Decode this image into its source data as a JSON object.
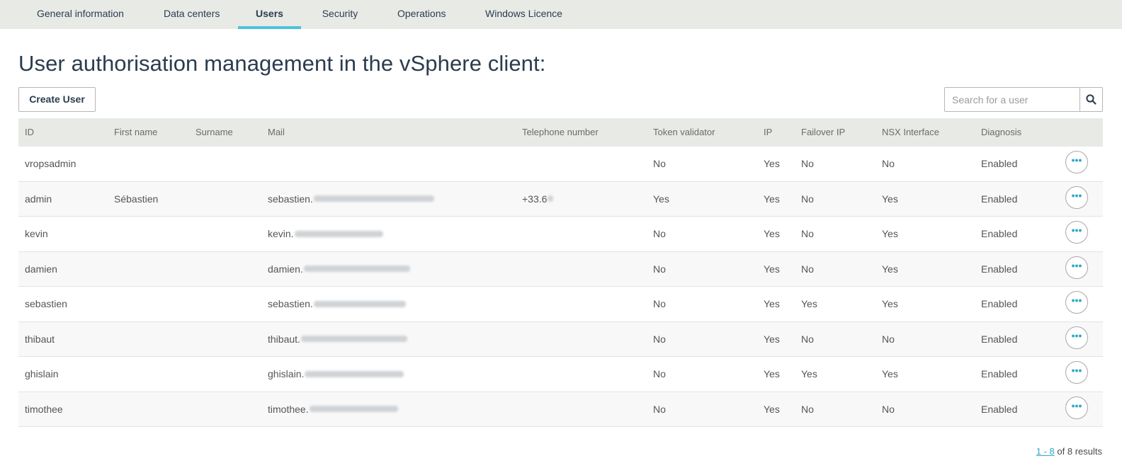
{
  "tabs": [
    {
      "label": "General information",
      "active": false
    },
    {
      "label": "Data centers",
      "active": false
    },
    {
      "label": "Users",
      "active": true
    },
    {
      "label": "Security",
      "active": false
    },
    {
      "label": "Operations",
      "active": false
    },
    {
      "label": "Windows Licence",
      "active": false
    }
  ],
  "page": {
    "title": "User authorisation management in the vSphere client:"
  },
  "toolbar": {
    "create_label": "Create User",
    "search_placeholder": "Search for a user",
    "search_icon": "search-icon"
  },
  "table": {
    "columns": [
      "ID",
      "First name",
      "Surname",
      "Mail",
      "Telephone number",
      "Token validator",
      "IP",
      "Failover IP",
      "NSX Interface",
      "Diagnosis"
    ],
    "rows": [
      {
        "id": "vropsadmin",
        "first_name": "",
        "surname": "",
        "mail": "",
        "phone": "",
        "token": "No",
        "ip": "Yes",
        "failover": "No",
        "nsx": "No",
        "diagnosis": "Enabled"
      },
      {
        "id": "admin",
        "first_name": "Sébastien",
        "surname": "",
        "mail": "sebastien.",
        "phone": "+33.6",
        "token": "Yes",
        "ip": "Yes",
        "failover": "No",
        "nsx": "Yes",
        "diagnosis": "Enabled"
      },
      {
        "id": "kevin",
        "first_name": "",
        "surname": "",
        "mail": "kevin.",
        "phone": "",
        "token": "No",
        "ip": "Yes",
        "failover": "No",
        "nsx": "Yes",
        "diagnosis": "Enabled"
      },
      {
        "id": "damien",
        "first_name": "",
        "surname": "",
        "mail": "damien.",
        "phone": "",
        "token": "No",
        "ip": "Yes",
        "failover": "No",
        "nsx": "Yes",
        "diagnosis": "Enabled"
      },
      {
        "id": "sebastien",
        "first_name": "",
        "surname": "",
        "mail": "sebastien.",
        "phone": "",
        "token": "No",
        "ip": "Yes",
        "failover": "Yes",
        "nsx": "Yes",
        "diagnosis": "Enabled"
      },
      {
        "id": "thibaut",
        "first_name": "",
        "surname": "",
        "mail": "thibaut.",
        "phone": "",
        "token": "No",
        "ip": "Yes",
        "failover": "No",
        "nsx": "No",
        "diagnosis": "Enabled"
      },
      {
        "id": "ghislain",
        "first_name": "",
        "surname": "",
        "mail": "ghislain.",
        "phone": "",
        "token": "No",
        "ip": "Yes",
        "failover": "Yes",
        "nsx": "Yes",
        "diagnosis": "Enabled"
      },
      {
        "id": "timothee",
        "first_name": "",
        "surname": "",
        "mail": "timothee.",
        "phone": "",
        "token": "No",
        "ip": "Yes",
        "failover": "No",
        "nsx": "No",
        "diagnosis": "Enabled"
      }
    ],
    "row_action_icon": "more-options-icon"
  },
  "pagination": {
    "range": "1 - 8",
    "suffix": "of 8 results"
  },
  "colors": {
    "accent": "#4bc1dd",
    "link": "#2fa9c7",
    "tabbar_bg": "#e8eae6",
    "header_bg": "#e8eae6"
  }
}
